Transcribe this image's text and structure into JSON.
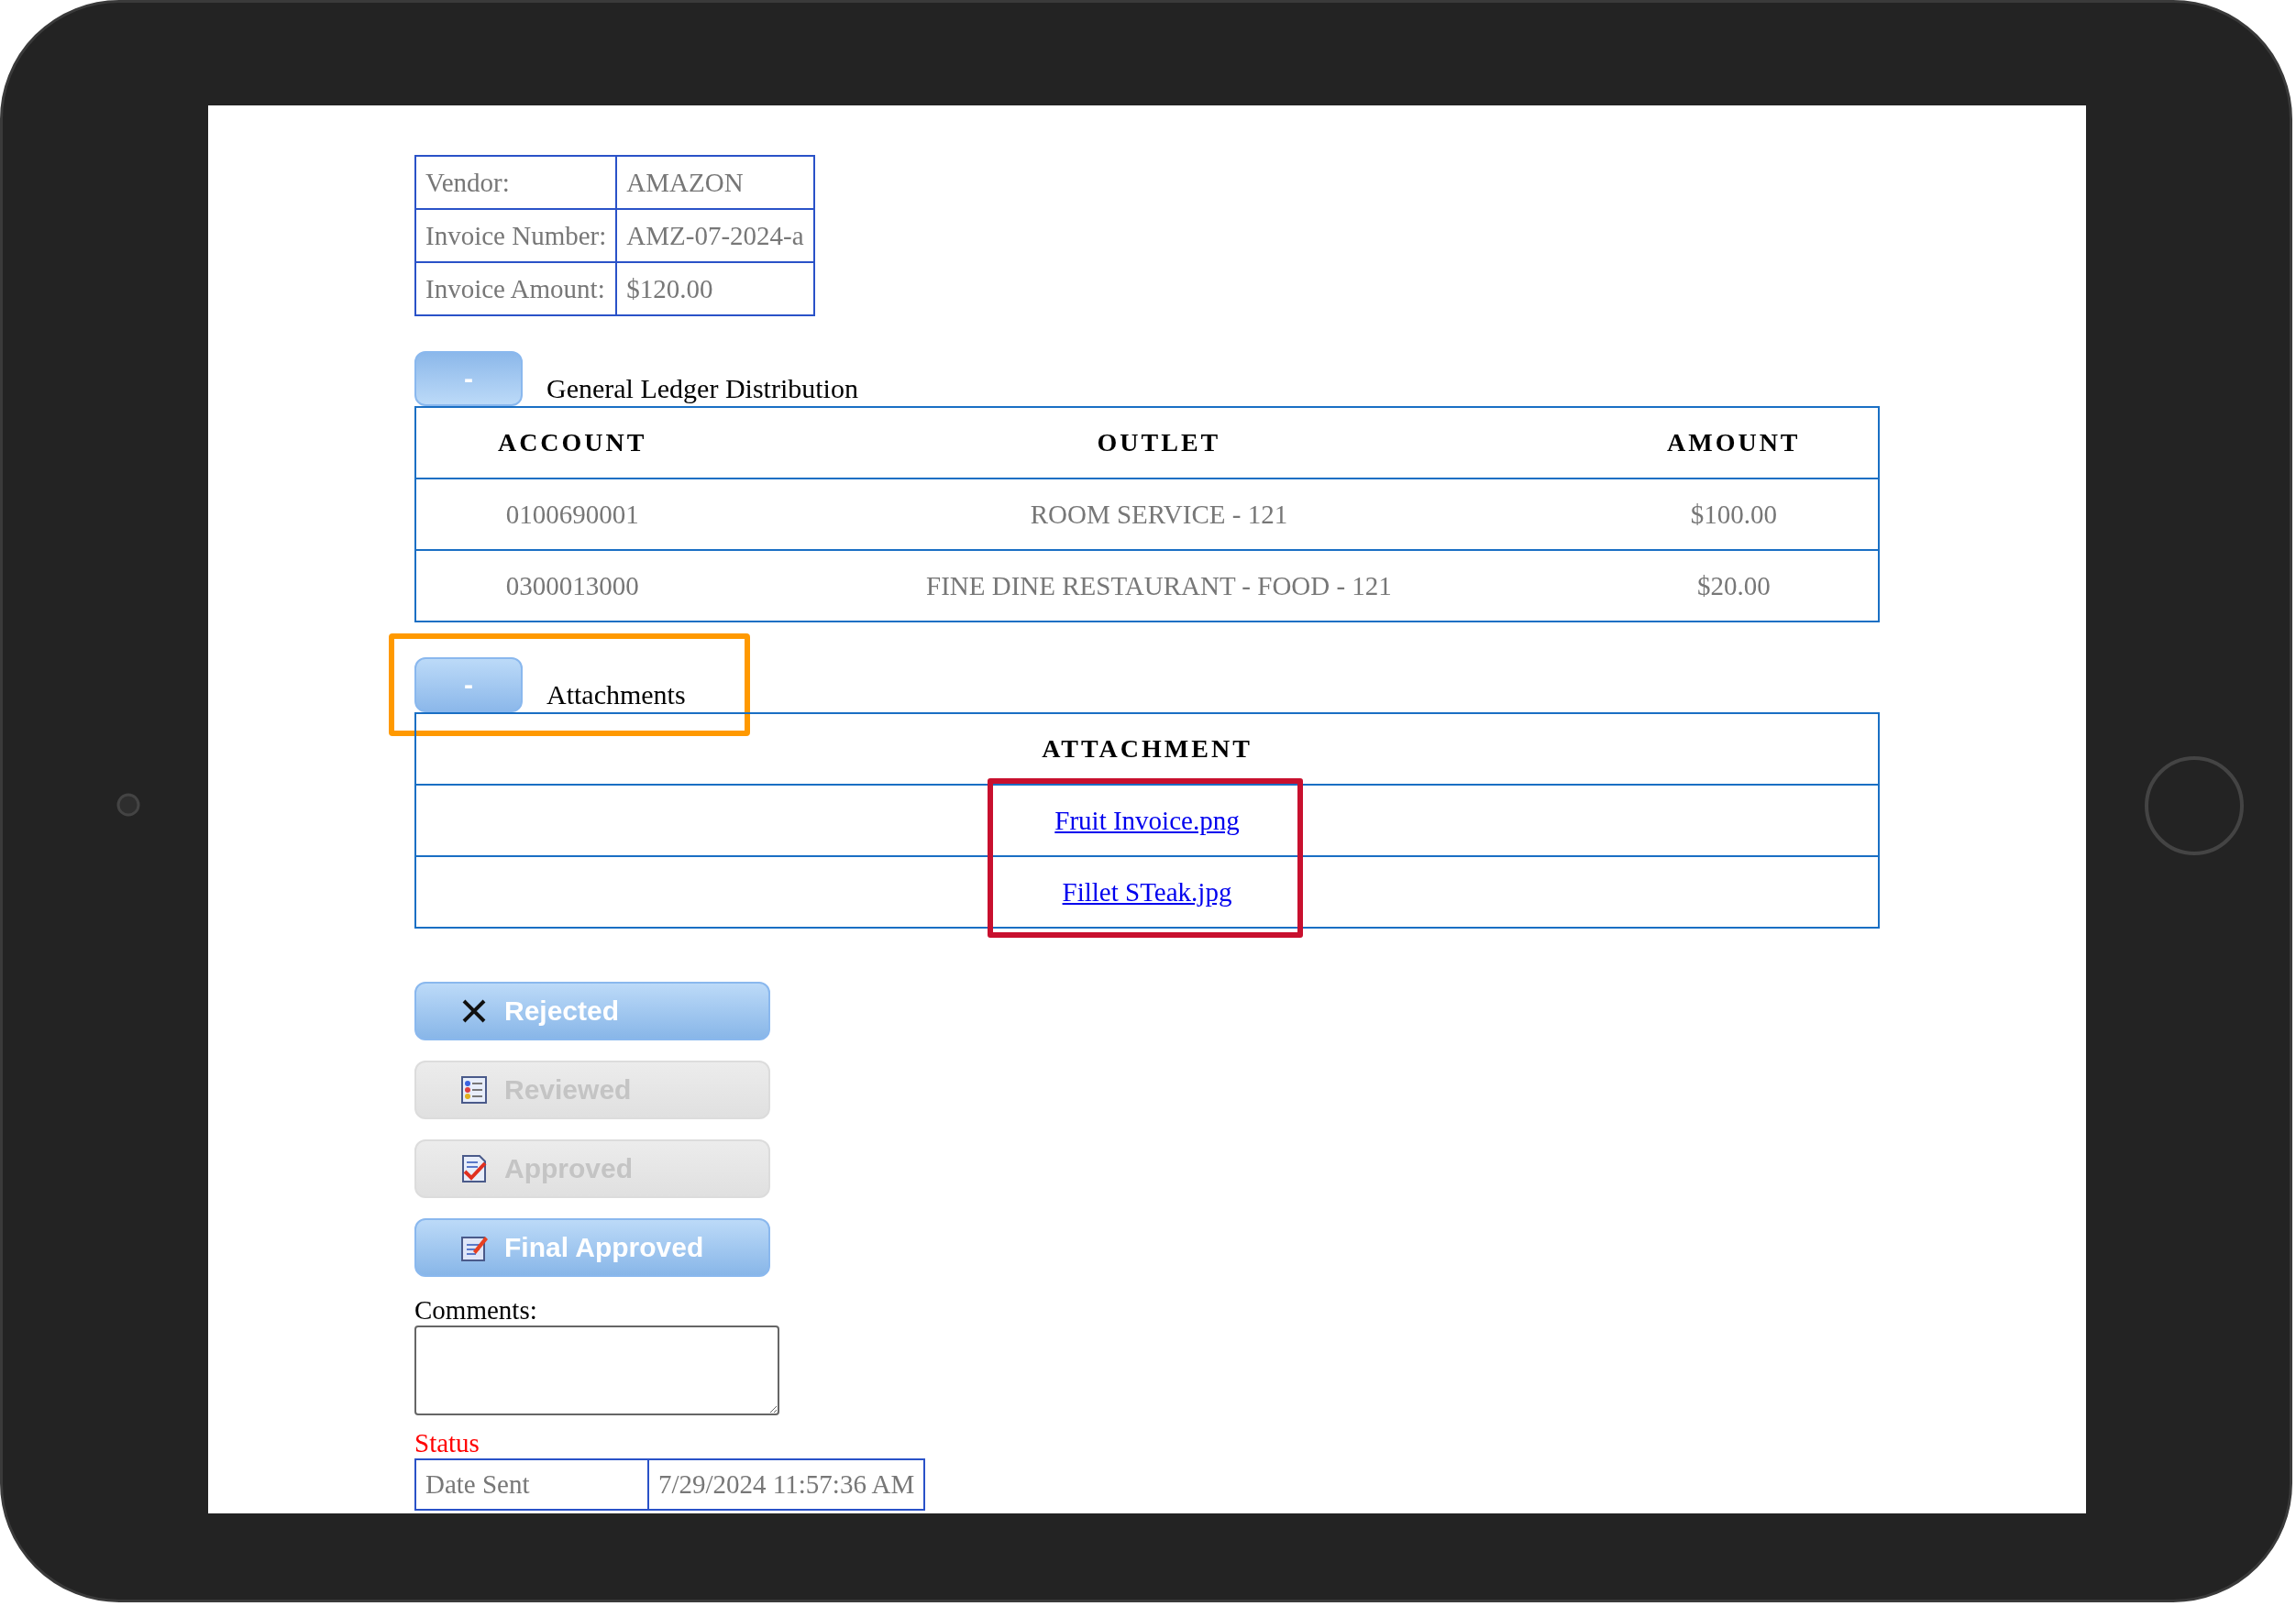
{
  "invoice": [
    {
      "label": "Vendor:",
      "value": "AMAZON"
    },
    {
      "label": "Invoice Number:",
      "value": "AMZ-07-2024-a"
    },
    {
      "label": "Invoice Amount:",
      "value": "$120.00"
    }
  ],
  "gl_section": {
    "toggle": "-",
    "title": "General Ledger Distribution"
  },
  "gl_table": {
    "columns": [
      "ACCOUNT",
      "OUTLET",
      "AMOUNT"
    ],
    "rows": [
      [
        "0100690001",
        "ROOM SERVICE - 121",
        "$100.00"
      ],
      [
        "0300013000",
        "FINE DINE RESTAURANT - FOOD - 121",
        "$20.00"
      ]
    ]
  },
  "attachments_section": {
    "toggle": "-",
    "title": "Attachments",
    "highlight": {
      "color": "#ff9900"
    }
  },
  "attachment_table": {
    "columns": [
      "ATTACHMENT"
    ],
    "links": [
      "Fruit Invoice.png",
      "Fillet STeak.jpg"
    ],
    "highlight": {
      "color": "#c8102e"
    }
  },
  "actions": [
    {
      "label": "Rejected",
      "kind": "reject",
      "disabled": false
    },
    {
      "label": "Reviewed",
      "kind": "review",
      "disabled": true
    },
    {
      "label": "Approved",
      "kind": "approve",
      "disabled": true
    },
    {
      "label": "Final Approved",
      "kind": "final",
      "disabled": false
    }
  ],
  "comments": {
    "label": "Comments:"
  },
  "status": {
    "title": "Status",
    "rows": [
      {
        "label": "Date Sent",
        "value": "7/29/2024 11:57:36 AM"
      }
    ]
  }
}
